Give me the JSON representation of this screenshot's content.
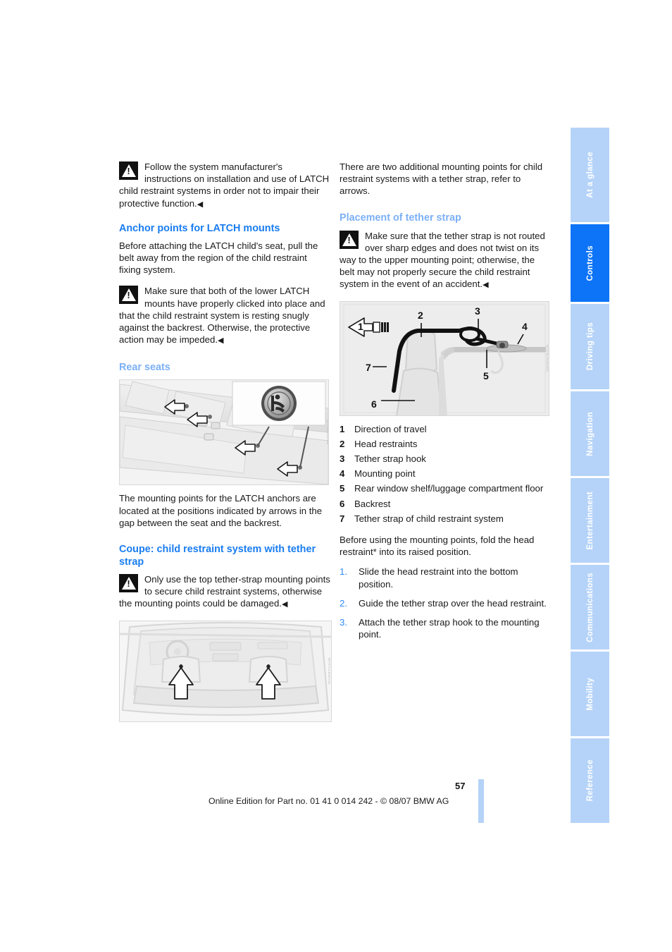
{
  "page": {
    "number": "57",
    "footer": "Online Edition for Part no. 01 41 0 014 242 - © 08/07 BMW AG"
  },
  "sidebar": {
    "tabs": [
      {
        "label": "At a glance",
        "active": false
      },
      {
        "label": "Controls",
        "active": true
      },
      {
        "label": "Driving tips",
        "active": false
      },
      {
        "label": "Navigation",
        "active": false
      },
      {
        "label": "Entertainment",
        "active": false
      },
      {
        "label": "Communications",
        "active": false
      },
      {
        "label": "Mobility",
        "active": false
      },
      {
        "label": "Reference",
        "active": false
      }
    ],
    "colors": {
      "inactive_bg": "#b5d3f8",
      "active_bg": "#0d74f7",
      "label": "#ffffff"
    }
  },
  "left_column": {
    "warning_1": "Follow the system manufacturer's instructions on installation and use of LATCH child restraint systems in order not to impair their protective function.",
    "heading_anchor": "Anchor points for LATCH mounts",
    "para_1": "Before attaching the LATCH child's seat, pull the belt away from the region of the child restraint fixing system.",
    "warning_2": "Make sure that both of the lower LATCH mounts have properly clicked into place and that the child restraint system is resting snugly against the backrest. Otherwise, the protective action may be impeded.",
    "heading_rear_seats": "Rear seats",
    "figure_rear_seats": {
      "code": "WYC5LB1EMM",
      "caption_alt": "Rear seat bench with four arrows pointing to LATCH anchor points and inset LATCH symbol badge"
    },
    "para_2": "The mounting points for the LATCH anchors are located at the positions indicated by arrows in the gap between the seat and the backrest.",
    "heading_coupe": "Coupe: child restraint system with tether strap",
    "warning_3": "Only use the top tether-strap mounting points to secure child restraint systems, otherwise the mounting points could be damaged.",
    "figure_coupe": {
      "code": "WYC7LLE11VUL",
      "caption_alt": "View through rear window of coupe interior with two arrows pointing to tether strap mounting points"
    }
  },
  "right_column": {
    "para_1": "There are two additional mounting points for child restraint systems with a tether strap, refer to arrows.",
    "heading_placement": "Placement of tether strap",
    "warning_1": "Make sure that the tether strap is not routed over sharp edges and does not twist on its way to the upper mounting point; otherwise, the belt may not properly secure the child restraint system in the event of an accident.",
    "figure_tether": {
      "code": "WYC5LHU02WS",
      "caption_alt": "Side view diagram of tether strap routed over head restraint to mounting point"
    },
    "legend": [
      {
        "num": "1",
        "text": "Direction of travel"
      },
      {
        "num": "2",
        "text": "Head restraints"
      },
      {
        "num": "3",
        "text": "Tether strap hook"
      },
      {
        "num": "4",
        "text": "Mounting point"
      },
      {
        "num": "5",
        "text": "Rear window shelf/luggage compartment floor"
      },
      {
        "num": "6",
        "text": "Backrest"
      },
      {
        "num": "7",
        "text": "Tether strap of child restraint system"
      }
    ],
    "para_before_steps_a": "Before using the mounting points, fold the head restraint",
    "para_before_steps_asterisk": "*",
    "para_before_steps_b": " into its raised position.",
    "steps": [
      {
        "num": "1.",
        "text": "Slide the head restraint into the bottom position."
      },
      {
        "num": "2.",
        "text": "Guide the tether strap over the head restraint."
      },
      {
        "num": "3.",
        "text": "Attach the tether strap hook to the mounting point."
      }
    ]
  },
  "icons": {
    "warning_triangle": "warning-triangle-icon",
    "end_mark": "◀"
  }
}
